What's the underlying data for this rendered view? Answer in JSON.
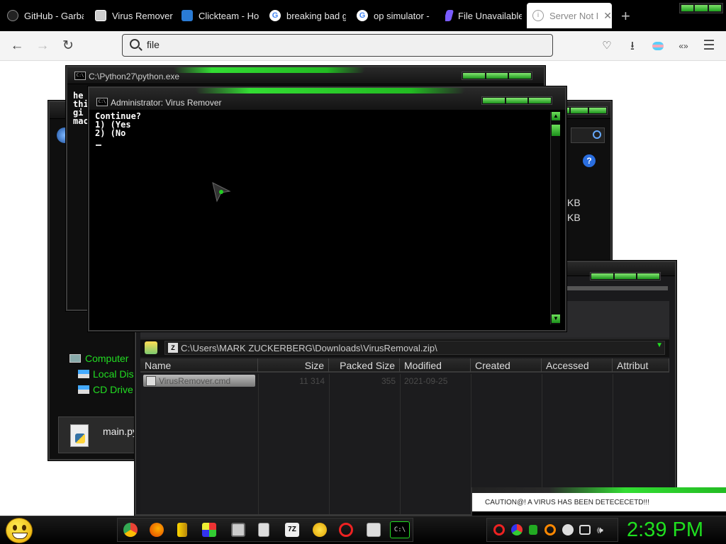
{
  "browser": {
    "tabs": [
      {
        "label": "GitHub - Garba",
        "icon": "github-icon",
        "color": "#e8e8e8"
      },
      {
        "label": "Virus Remover",
        "icon": "image-icon",
        "color": "#ffffff"
      },
      {
        "label": "Clickteam - Ho",
        "icon": "clickteam-icon",
        "color": "#2a7bd5"
      },
      {
        "label": "breaking bad g",
        "icon": "google-icon",
        "color": "#ffffff"
      },
      {
        "label": "op simulator -",
        "icon": "google-icon",
        "color": "#ffffff"
      },
      {
        "label": "File Unavailable",
        "icon": "file-icon",
        "color": "#7a5cff"
      },
      {
        "label": "Server Not F",
        "icon": "info-icon",
        "color": "#aaaaaa"
      }
    ],
    "new_tab": "+",
    "address": "file",
    "nav": {
      "back": "←",
      "forward": "→",
      "reload": "↻"
    },
    "toolbar_icons": [
      "pocket-icon",
      "download-icon",
      "extension-icon",
      "tabs-icon",
      "menu-icon"
    ]
  },
  "python_window": {
    "title": "C:\\Python27\\python.exe",
    "lines": [
      "he",
      "thi",
      "gi",
      "mac"
    ]
  },
  "console_window": {
    "title": "Administrator:  Virus Remover",
    "lines": [
      "Continue?",
      "1) (Yes",
      "2) (No"
    ]
  },
  "explorer_window": {
    "sidebar": [
      "Computer",
      "Local Disk",
      "CD Drive (E"
    ],
    "size_labels": [
      "KB",
      "KB"
    ],
    "pinned_file": "main.py"
  },
  "zip_window": {
    "path": "C:\\Users\\MARK ZUCKERBERG\\Downloads\\VirusRemoval.zip\\",
    "columns": [
      "Name",
      "Size",
      "Packed Size",
      "Modified",
      "Created",
      "Accessed",
      "Attribut"
    ],
    "rows": [
      {
        "name": "VirusRemover.cmd",
        "size": "11 314",
        "packed": "355",
        "modified": "2021-09-25",
        "created": "",
        "accessed": "",
        "attrib": ""
      }
    ]
  },
  "alert": {
    "text": "CAUTION@! A VIRUS HAS BEEN DETECECETD!!!"
  },
  "taskbar": {
    "clock": "2:39 PM"
  },
  "colors": {
    "accent": "#22dd22",
    "window_bg": "#0f0f0f"
  }
}
